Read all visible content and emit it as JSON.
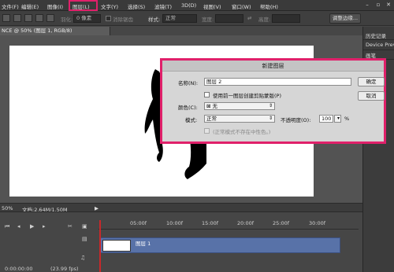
{
  "menubar": {
    "items": [
      "文件(F)",
      "编辑(E)",
      "图像(I)",
      "图层(L)",
      "文字(Y)",
      "选择(S)",
      "滤镜(T)",
      "3D(D)",
      "视图(V)",
      "窗口(W)",
      "帮助(H)"
    ]
  },
  "options": {
    "feather_label": "羽化:",
    "feather_value": "0 像素",
    "antialias_label": "消除锯齿",
    "style_label": "样式:",
    "style_value": "正常",
    "width_label": "宽度:",
    "height_label": "高度:",
    "refine_button": "调整边缘..."
  },
  "document": {
    "tab_title": "NCE @ 50% (图层 1, RGB/8)"
  },
  "right_panel": {
    "items": [
      "历史记录",
      "Device Previ",
      "画笔",
      "选区"
    ]
  },
  "status": {
    "zoom": "50%",
    "doc_info": "文档:2.64M/1.50M"
  },
  "timeline": {
    "ticks": [
      "05:00f",
      "10:00f",
      "15:00f",
      "20:00f",
      "25:00f",
      "30:00f"
    ],
    "track_label": "图层 1",
    "timecode": "0:00:00:00",
    "fps": "(23.99 fps)"
  },
  "dialog": {
    "title": "新建图层",
    "name_label": "名称(N):",
    "name_value": "图层 2",
    "clip_label": "使用前一图层创建剪贴蒙版(P)",
    "color_label": "颜色(C):",
    "color_value": "无",
    "mode_label": "模式:",
    "mode_value": "正常",
    "opacity_label": "不透明度(O):",
    "opacity_value": "100",
    "opacity_unit": "%",
    "neutral_label": "(正常模式不存在中性色。)",
    "ok_button": "确定",
    "cancel_button": "取消"
  },
  "colors": {
    "highlight": "#e0206a",
    "timeline_track": "#5872a8",
    "playhead": "#c8282a"
  }
}
